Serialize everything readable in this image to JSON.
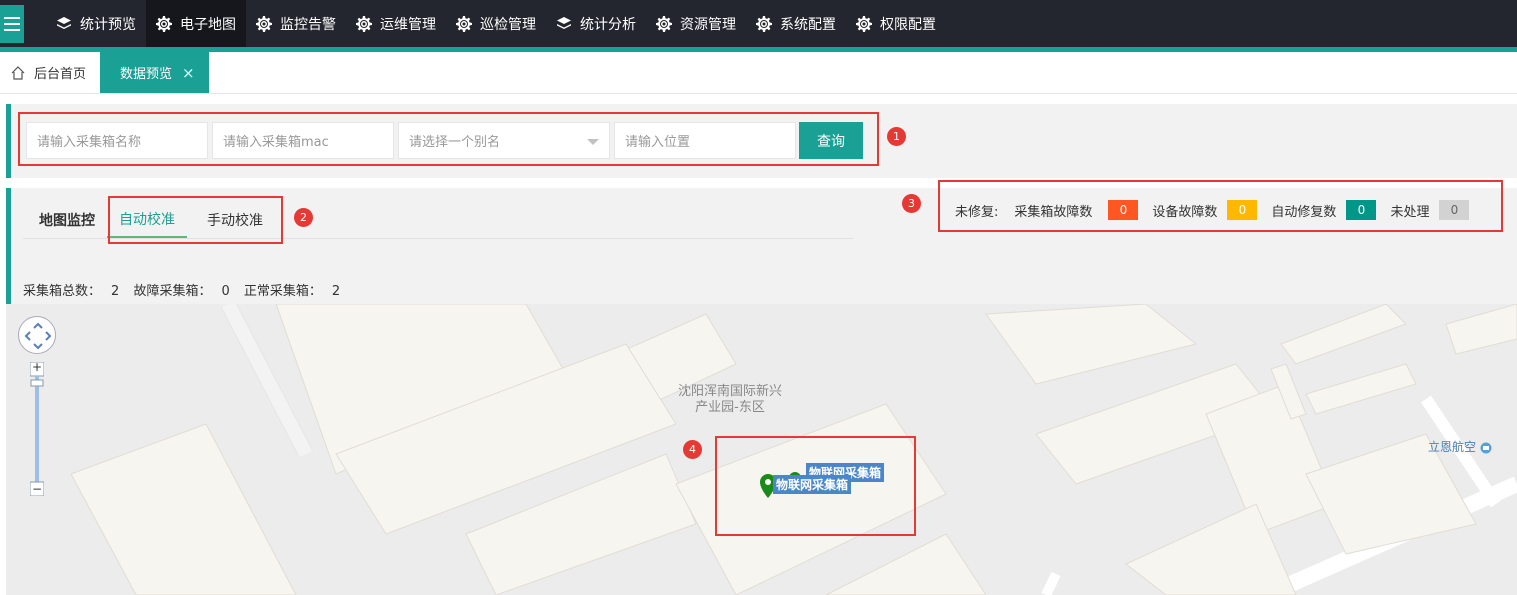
{
  "nav": {
    "items": [
      {
        "label": "统计预览",
        "icon": "layers-icon"
      },
      {
        "label": "电子地图",
        "icon": "gear-icon",
        "active": true
      },
      {
        "label": "监控告警",
        "icon": "gear-icon"
      },
      {
        "label": "运维管理",
        "icon": "gear-icon"
      },
      {
        "label": "巡检管理",
        "icon": "gear-icon"
      },
      {
        "label": "统计分析",
        "icon": "layers-icon"
      },
      {
        "label": "资源管理",
        "icon": "gear-icon"
      },
      {
        "label": "系统配置",
        "icon": "gear-icon"
      },
      {
        "label": "权限配置",
        "icon": "gear-icon"
      }
    ]
  },
  "tabs": {
    "home": "后台首页",
    "current": "数据预览",
    "close": "×"
  },
  "search": {
    "name_placeholder": "请输入采集箱名称",
    "mac_placeholder": "请输入采集箱mac",
    "alias_placeholder": "请选择一个别名",
    "location_placeholder": "请输入位置",
    "query_label": "查询"
  },
  "info": {
    "tab_map": "地图监控",
    "tab_auto": "自动校准",
    "tab_manual": "手动校准",
    "stats": {
      "total_label": "采集箱总数：",
      "total": "2",
      "fault_label": "故障采集箱：",
      "fault": "0",
      "normal_label": "正常采集箱：",
      "normal": "2"
    }
  },
  "legend": {
    "unrepaired_label": "未修复:",
    "box_fault_label": "采集箱故障数",
    "box_fault": "0",
    "device_fault_label": "设备故障数",
    "device_fault": "0",
    "auto_repair_label": "自动修复数",
    "auto_repair": "0",
    "unprocessed_label": "未处理",
    "unprocessed": "0"
  },
  "map": {
    "area_label_line1": "沈阳浑南国际新兴",
    "area_label_line2": "产业园-东区",
    "poi_label": "立恩航空",
    "marker1_label": "物联网采集箱",
    "marker2_label": "物联网采集箱",
    "zoom_in": "+",
    "zoom_out": "−"
  },
  "annotations": [
    "1",
    "2",
    "3",
    "4"
  ],
  "colors": {
    "accent": "#1aa094",
    "nav_bg": "#23262e",
    "badge_orange": "#ff5722",
    "badge_yellow": "#ffb800",
    "badge_teal": "#009688",
    "badge_gray": "#d2d2d2",
    "marker_green": "#1a8a1a",
    "annotation_red": "#e53935"
  }
}
